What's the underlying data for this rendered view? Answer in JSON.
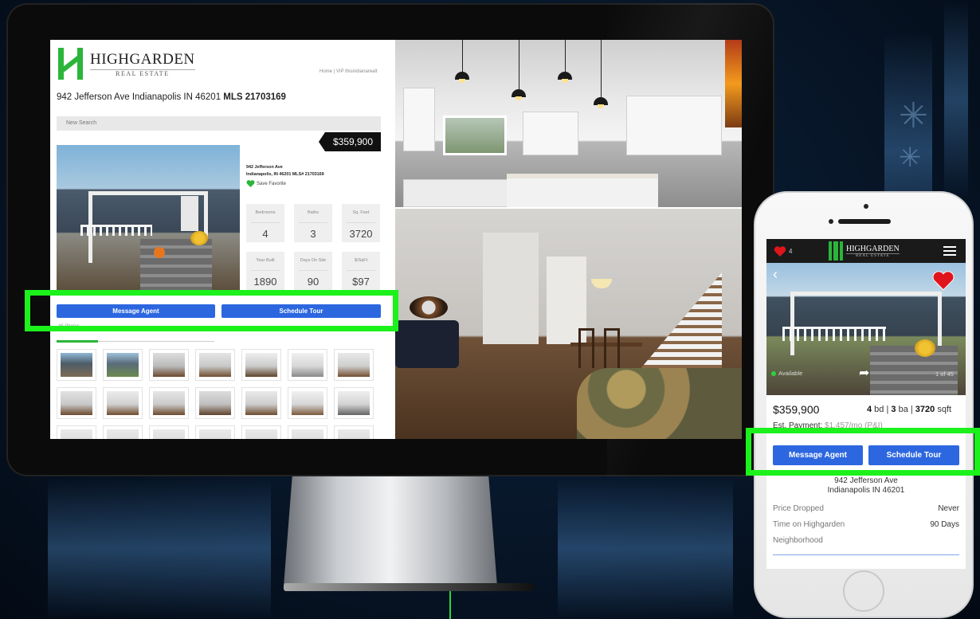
{
  "desktop": {
    "brand": {
      "name": "HIGHGARDEN",
      "tagline": "REAL ESTATE"
    },
    "nav": "Home  |  VIP thisindianarealt",
    "address_line": "942 Jefferson Ave Indianapolis IN 46201 ",
    "mls_label": "MLS 21703169",
    "new_search_label": "New Search",
    "price": "$359,900",
    "info_address_line1": "942 Jefferson Ave",
    "info_address_line2": "Indianapolis, IN 46201 MLS# 21703169",
    "save_favorite_label": "Save Favorite",
    "stats": [
      {
        "label": "Bedrooms",
        "value": "4"
      },
      {
        "label": "Baths",
        "value": "3"
      },
      {
        "label": "Sq. Feet",
        "value": "3720"
      },
      {
        "label": "Year Built",
        "value": "1890"
      },
      {
        "label": "Days On Site",
        "value": "90"
      },
      {
        "label": "$/SqFt",
        "value": "$97"
      }
    ],
    "message_agent_label": "Message Agent",
    "schedule_tour_label": "Schedule Tour",
    "photos_label": "45 Photos"
  },
  "mobile": {
    "favorites_count": "4",
    "brand": {
      "name": "HIGHGARDEN",
      "tagline": "REAL ESTATE"
    },
    "availability": "Available",
    "photo_index": "1 of 45",
    "price": "$359,900",
    "beds": "4",
    "beds_unit": " bd | ",
    "baths": "3",
    "baths_unit": " ba | ",
    "sqft": "3720",
    "sqft_unit": " sqft",
    "est_payment_label": "Est. Payment: ",
    "est_payment_value": "$1,457/mo (P&I)",
    "message_agent_label": "Message Agent",
    "schedule_tour_label": "Schedule Tour",
    "address_line1": "942 Jefferson Ave",
    "address_line2": "Indianapolis IN 46201",
    "details": [
      {
        "label": "Price Dropped",
        "value": "Never"
      },
      {
        "label": "Time on Highgarden",
        "value": "90 Days"
      },
      {
        "label": "Neighborhood",
        "value": ""
      }
    ]
  },
  "colors": {
    "accent_blue": "#2c67e0",
    "highlight_green": "#1cf11c",
    "brand_green": "#2bb53a",
    "heart_red": "#e0151b"
  },
  "icons": [
    "heart-icon",
    "hamburger-menu-icon",
    "chevron-left-icon",
    "share-icon",
    "status-dot-icon"
  ]
}
